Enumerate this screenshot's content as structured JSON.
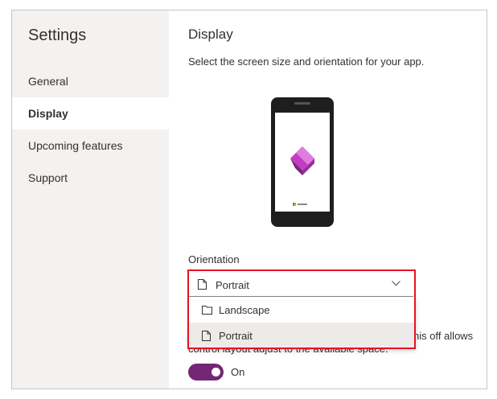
{
  "sidebar": {
    "title": "Settings",
    "items": [
      {
        "label": "General",
        "active": false
      },
      {
        "label": "Display",
        "active": true
      },
      {
        "label": "Upcoming features",
        "active": false
      },
      {
        "label": "Support",
        "active": false
      }
    ]
  },
  "main": {
    "title": "Display",
    "description": "Select the screen size and orientation for your app.",
    "orientation": {
      "label": "Orientation",
      "selected_value": "Portrait",
      "options": [
        {
          "label": "Landscape",
          "selected": false
        },
        {
          "label": "Portrait",
          "selected": true
        }
      ]
    },
    "partial_text": "his off allows",
    "partial_line_2": "control layout adjust to the available space.",
    "toggle": {
      "state": "On",
      "on": true
    }
  },
  "colors": {
    "accent": "#742774",
    "highlight_border": "#e81123",
    "sidebar_bg": "#f3f2f1",
    "selected_option_bg": "#edebe9"
  },
  "icons": {
    "dropdown_prefix": "document-icon",
    "dropdown_chevron": "chevron-down-icon",
    "option_prefix": "document-icon",
    "app_logo": "power-apps-logo"
  }
}
